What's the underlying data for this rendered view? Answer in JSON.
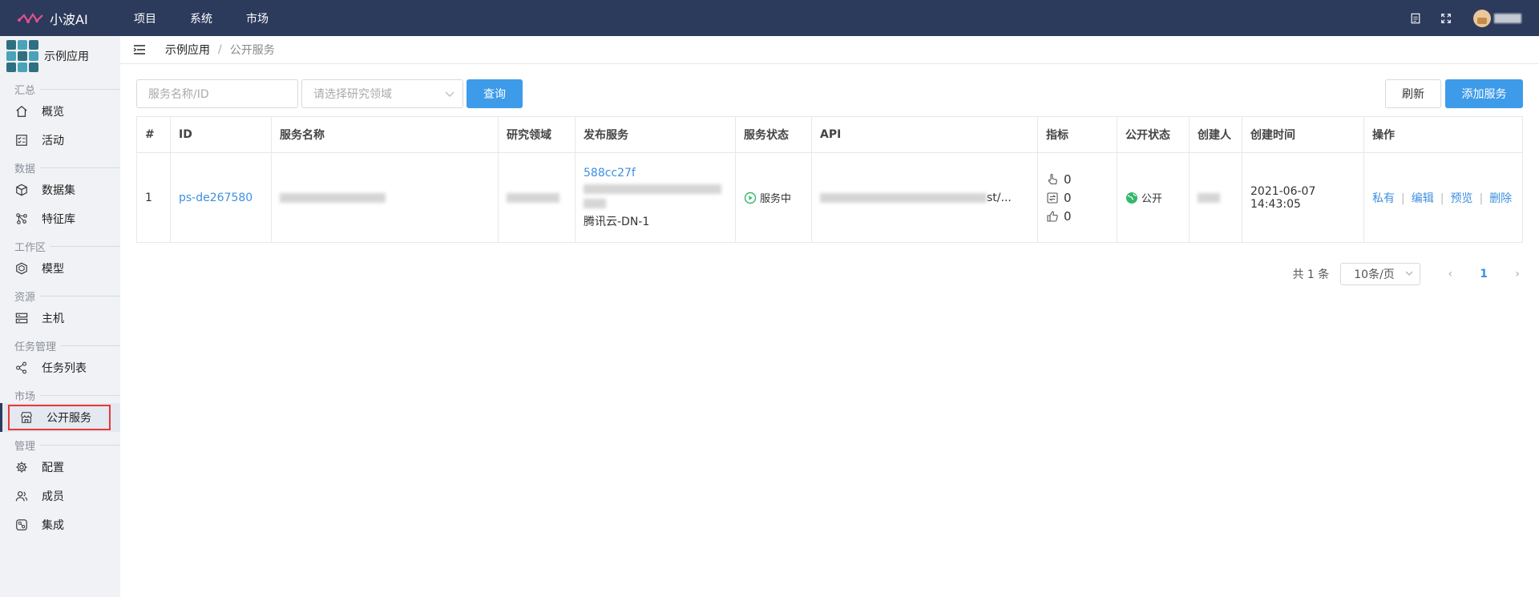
{
  "brand": {
    "name": "小波AI"
  },
  "topnav": [
    {
      "label": "项目"
    },
    {
      "label": "系统"
    },
    {
      "label": "市场"
    }
  ],
  "sidebar": {
    "app_name": "示例应用",
    "sections": {
      "summary": "汇总",
      "data": "数据",
      "workspace": "工作区",
      "resources": "资源",
      "tasks": "任务管理",
      "market": "市场",
      "manage": "管理"
    },
    "items": {
      "overview": "概览",
      "activity": "活动",
      "dataset": "数据集",
      "features": "特征库",
      "model": "模型",
      "host": "主机",
      "task_list": "任务列表",
      "public_service": "公开服务",
      "config": "配置",
      "members": "成员",
      "integration": "集成"
    }
  },
  "breadcrumb": {
    "app": "示例应用",
    "separator": "/",
    "current": "公开服务"
  },
  "toolbar": {
    "name_placeholder": "服务名称/ID",
    "domain_placeholder": "请选择研究领域",
    "query_label": "查询",
    "refresh_label": "刷新",
    "add_label": "添加服务"
  },
  "table": {
    "headers": [
      "#",
      "ID",
      "服务名称",
      "研究领域",
      "发布服务",
      "服务状态",
      "API",
      "指标",
      "公开状态",
      "创建人",
      "创建时间",
      "操作"
    ],
    "rows": [
      {
        "index": "1",
        "id": "ps-de267580",
        "published_id": "588cc27f",
        "published_region": "腾讯云-DN-1",
        "status": "服务中",
        "api_suffix": "st/...",
        "metric_clicks": "0",
        "metric_calls": "0",
        "metric_likes": "0",
        "public_status": "公开",
        "created_at": "2021-06-07 14:43:05",
        "ops": {
          "private": "私有",
          "edit": "编辑",
          "preview": "预览",
          "delete": "删除"
        }
      }
    ]
  },
  "pager": {
    "total": "共 1 条",
    "page_size": "10条/页",
    "current_page": "1"
  },
  "colors": {
    "topbar": "#2c3a5c",
    "primary": "#3d9be9",
    "link": "#3d8fe0",
    "status_green": "#34b86b",
    "highlight_red": "#e53935"
  }
}
